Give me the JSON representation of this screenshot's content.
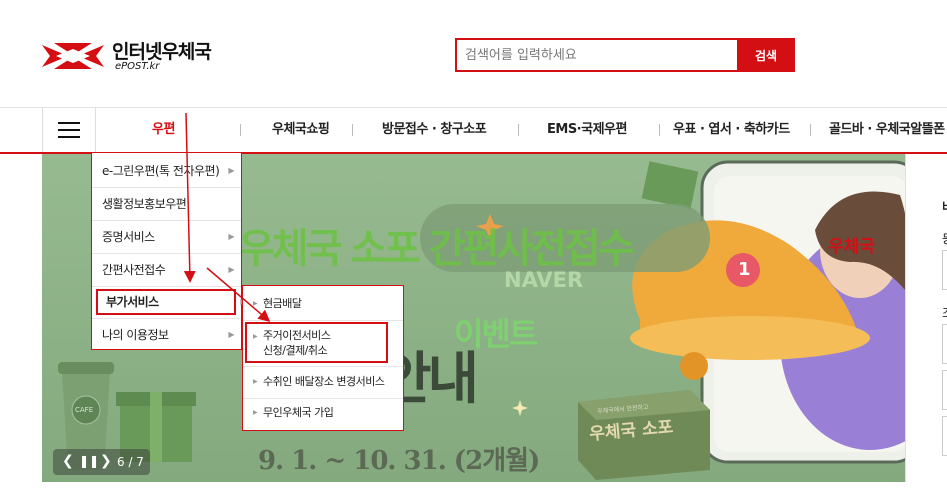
{
  "header": {
    "logo_title": "인터넷우체국",
    "logo_sub": "ePOST.kr",
    "search_placeholder": "검색어를 입력하세요",
    "search_button": "검색"
  },
  "gnb": {
    "items": [
      {
        "label": "우편",
        "active": true
      },
      {
        "label": "우체국쇼핑"
      },
      {
        "label": "방문접수 · 창구소포"
      },
      {
        "label": "EMS·국제우편"
      },
      {
        "label": "우표 · 엽서 · 축하카드"
      },
      {
        "label": "골드바 · 우체국알뜰폰"
      }
    ]
  },
  "dropdown": {
    "items": [
      {
        "label": "e-그린우편(톡 전자우편)"
      },
      {
        "label": "생활정보홍보우편"
      },
      {
        "label": "증명서비스"
      },
      {
        "label": "간편사전접수"
      },
      {
        "label": "부가서비스",
        "highlighted": true
      },
      {
        "label": "나의 이용정보"
      }
    ]
  },
  "submenu": {
    "items": [
      {
        "label": "현금배달"
      },
      {
        "label": "주거이전서비스",
        "label2": "신청/결제/취소",
        "highlighted": true
      },
      {
        "label": "수취인 배달장소 변경서비스"
      },
      {
        "label": "무인우체국 가입"
      }
    ]
  },
  "banner": {
    "headline_a": "우체국 소포 간편사전접수",
    "naver_badge": "NAVER",
    "event_text": "이벤트",
    "headline_b": "안내",
    "phone_brand": "우체국",
    "notification_count": "1",
    "box_label": "우체국 소포",
    "box_small": "우체국에서 안전하고",
    "cup_label": "CAFE",
    "period": "9. 1. ~ 10. 31. (2개월)"
  },
  "slider": {
    "counter": "6 / 7",
    "prev_glyph": "❮",
    "pause_glyph": "❚❚",
    "next_glyph": "❯"
  },
  "right_panel": {
    "chars": [
      "비",
      "등",
      "조"
    ]
  },
  "colors": {
    "brand_red": "#d40f14",
    "banner_green": "#8fb388",
    "bell_orange": "#f0a93b"
  }
}
